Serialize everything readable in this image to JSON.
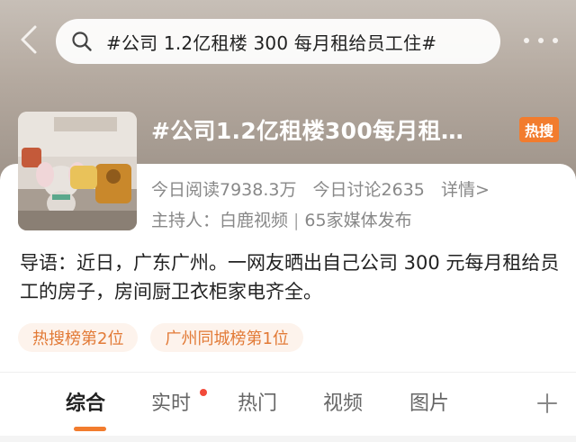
{
  "search": {
    "query": "#公司 1.2亿租楼 300 每月租给员工住#"
  },
  "topic": {
    "title": "#公司1.2亿租楼300每月租…",
    "badge": "热搜",
    "reads": "今日阅读7938.3万",
    "discussions": "今日讨论2635",
    "detail_link": "详情>",
    "host": "主持人：白鹿视频",
    "media": "65家媒体发布",
    "intro": "导语：近日，广东广州。一网友晒出自己公司 300 元每月租给员工的房子，房间厨卫衣柜家电齐全。"
  },
  "tags": [
    "热搜榜第2位",
    "广州同城榜第1位"
  ],
  "tabs": [
    {
      "label": "综合",
      "active": true
    },
    {
      "label": "实时",
      "active": false
    },
    {
      "label": "热门",
      "active": false
    },
    {
      "label": "视频",
      "active": false
    },
    {
      "label": "图片",
      "active": false
    }
  ],
  "colors": {
    "accent": "#f27c2e",
    "tag_bg": "#fdf3ec",
    "notification_dot": "#f24a3a"
  }
}
